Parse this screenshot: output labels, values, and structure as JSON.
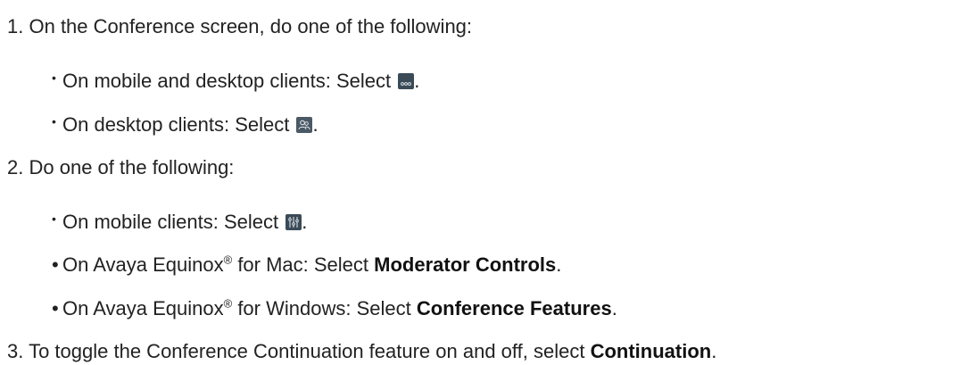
{
  "steps": [
    {
      "number": "1.",
      "text": "On the Conference screen, do one of the following:",
      "bullets": [
        {
          "pre": "On mobile and desktop clients: Select ",
          "icon": "more-options-icon",
          "post": "."
        },
        {
          "pre": "On desktop clients: Select ",
          "icon": "participants-icon",
          "post": "."
        }
      ]
    },
    {
      "number": "2.",
      "text": "Do one of the following:",
      "bullets": [
        {
          "pre": "On mobile clients: Select ",
          "icon": "conference-controls-icon",
          "post": "."
        },
        {
          "pre": "On Avaya Equinox",
          "sup": "®",
          "mid": " for Mac: Select ",
          "bold": "Moderator Controls",
          "post": "."
        },
        {
          "pre": "On Avaya Equinox",
          "sup": "®",
          "mid": " for Windows: Select ",
          "bold": "Conference Features",
          "post": "."
        }
      ]
    },
    {
      "number": "3.",
      "text": "To toggle the Conference Continuation feature on and off, select ",
      "bold": "Continuation",
      "post": "."
    }
  ],
  "colors": {
    "icon_bg": "#3b4a57",
    "icon_fg": "#e6edf2",
    "text": "#222222"
  }
}
